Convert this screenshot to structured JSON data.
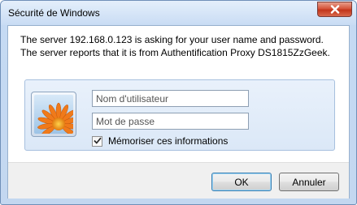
{
  "window": {
    "title": "Sécurité de Windows"
  },
  "message": {
    "text": "The server 192.168.0.123 is asking for your user name and password. The server reports that it is from Authentification Proxy DS1815ZzGeek."
  },
  "credentials": {
    "username_placeholder": "Nom d'utilisateur",
    "username_value": "",
    "password_placeholder": "Mot de passe",
    "password_value": "",
    "remember_label": "Mémoriser ces informations",
    "remember_checked": true
  },
  "buttons": {
    "ok_label": "OK",
    "cancel_label": "Annuler"
  },
  "icons": {
    "close": "close-icon",
    "avatar": "flower-user-tile",
    "checkmark": "checkmark-icon"
  },
  "colors": {
    "close_button": "#c2351b",
    "frame": "#c5daf3",
    "default_button_border": "#3c7fb1"
  }
}
